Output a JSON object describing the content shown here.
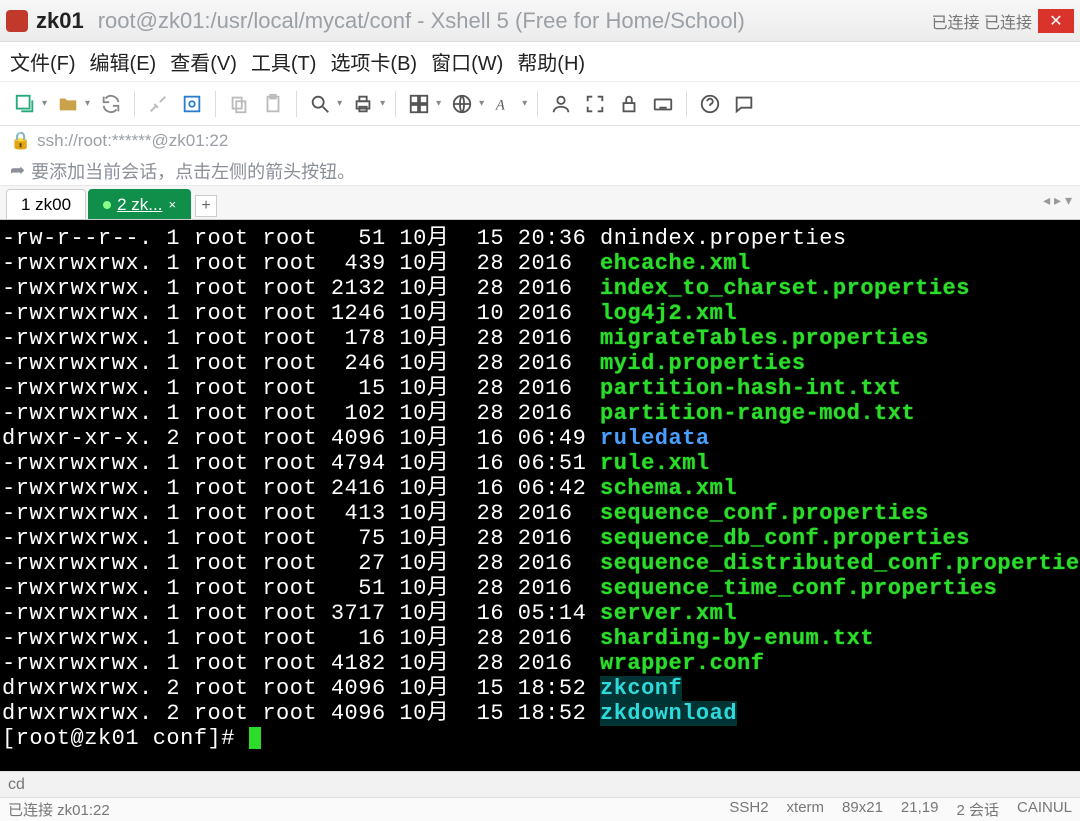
{
  "title": {
    "session_name": "zk01",
    "full": "root@zk01:/usr/local/mycat/conf - Xshell 5 (Free for Home/School)",
    "conn_status": "已连接 已连接"
  },
  "menu": {
    "file": "文件(F)",
    "edit": "编辑(E)",
    "view": "查看(V)",
    "tools": "工具(T)",
    "tab": "选项卡(B)",
    "window": "窗口(W)",
    "help": "帮助(H)"
  },
  "addr": {
    "icon": "🔒",
    "text": "ssh://root:******@zk01:22"
  },
  "hint": {
    "icon": "➦",
    "text": "要添加当前会话，点击左侧的箭头按钮。"
  },
  "tabs": {
    "t1": "1 zk00",
    "t2": "2 zk...",
    "add": "+"
  },
  "files": [
    {
      "perm": "rw-r--r--.",
      "n": "1",
      "u": "root",
      "g": "root",
      "sz": "  51",
      "m": "10月",
      "d": "15",
      "t": "20:36",
      "name": "dnindex.properties",
      "cls": ""
    },
    {
      "perm": "rwxrwxrwx.",
      "n": "1",
      "u": "root",
      "g": "root",
      "sz": " 439",
      "m": "10月",
      "d": "28",
      "t": "2016 ",
      "name": "ehcache.xml",
      "cls": "fg-green"
    },
    {
      "perm": "rwxrwxrwx.",
      "n": "1",
      "u": "root",
      "g": "root",
      "sz": "2132",
      "m": "10月",
      "d": "28",
      "t": "2016 ",
      "name": "index_to_charset.properties",
      "cls": "fg-green"
    },
    {
      "perm": "rwxrwxrwx.",
      "n": "1",
      "u": "root",
      "g": "root",
      "sz": "1246",
      "m": "10月",
      "d": "10",
      "t": "2016 ",
      "name": "log4j2.xml",
      "cls": "fg-green"
    },
    {
      "perm": "rwxrwxrwx.",
      "n": "1",
      "u": "root",
      "g": "root",
      "sz": " 178",
      "m": "10月",
      "d": "28",
      "t": "2016 ",
      "name": "migrateTables.properties",
      "cls": "fg-green"
    },
    {
      "perm": "rwxrwxrwx.",
      "n": "1",
      "u": "root",
      "g": "root",
      "sz": " 246",
      "m": "10月",
      "d": "28",
      "t": "2016 ",
      "name": "myid.properties",
      "cls": "fg-green"
    },
    {
      "perm": "rwxrwxrwx.",
      "n": "1",
      "u": "root",
      "g": "root",
      "sz": "  15",
      "m": "10月",
      "d": "28",
      "t": "2016 ",
      "name": "partition-hash-int.txt",
      "cls": "fg-green"
    },
    {
      "perm": "rwxrwxrwx.",
      "n": "1",
      "u": "root",
      "g": "root",
      "sz": " 102",
      "m": "10月",
      "d": "28",
      "t": "2016 ",
      "name": "partition-range-mod.txt",
      "cls": "fg-green"
    },
    {
      "perm": "drwxr-xr-x.",
      "n": "2",
      "u": "root",
      "g": "root",
      "sz": "4096",
      "m": "10月",
      "d": "16",
      "t": "06:49",
      "name": "ruledata",
      "cls": "fg-blue",
      "pad": ""
    },
    {
      "perm": "rwxrwxrwx.",
      "n": "1",
      "u": "root",
      "g": "root",
      "sz": "4794",
      "m": "10月",
      "d": "16",
      "t": "06:51",
      "name": "rule.xml",
      "cls": "fg-green"
    },
    {
      "perm": "rwxrwxrwx.",
      "n": "1",
      "u": "root",
      "g": "root",
      "sz": "2416",
      "m": "10月",
      "d": "16",
      "t": "06:42",
      "name": "schema.xml",
      "cls": "fg-green"
    },
    {
      "perm": "rwxrwxrwx.",
      "n": "1",
      "u": "root",
      "g": "root",
      "sz": " 413",
      "m": "10月",
      "d": "28",
      "t": "2016 ",
      "name": "sequence_conf.properties",
      "cls": "fg-green"
    },
    {
      "perm": "rwxrwxrwx.",
      "n": "1",
      "u": "root",
      "g": "root",
      "sz": "  75",
      "m": "10月",
      "d": "28",
      "t": "2016 ",
      "name": "sequence_db_conf.properties",
      "cls": "fg-green"
    },
    {
      "perm": "rwxrwxrwx.",
      "n": "1",
      "u": "root",
      "g": "root",
      "sz": "  27",
      "m": "10月",
      "d": "28",
      "t": "2016 ",
      "name": "sequence_distributed_conf.properties",
      "cls": "fg-green"
    },
    {
      "perm": "rwxrwxrwx.",
      "n": "1",
      "u": "root",
      "g": "root",
      "sz": "  51",
      "m": "10月",
      "d": "28",
      "t": "2016 ",
      "name": "sequence_time_conf.properties",
      "cls": "fg-green"
    },
    {
      "perm": "rwxrwxrwx.",
      "n": "1",
      "u": "root",
      "g": "root",
      "sz": "3717",
      "m": "10月",
      "d": "16",
      "t": "05:14",
      "name": "server.xml",
      "cls": "fg-green"
    },
    {
      "perm": "rwxrwxrwx.",
      "n": "1",
      "u": "root",
      "g": "root",
      "sz": "  16",
      "m": "10月",
      "d": "28",
      "t": "2016 ",
      "name": "sharding-by-enum.txt",
      "cls": "fg-green"
    },
    {
      "perm": "rwxrwxrwx.",
      "n": "1",
      "u": "root",
      "g": "root",
      "sz": "4182",
      "m": "10月",
      "d": "28",
      "t": "2016 ",
      "name": "wrapper.conf",
      "cls": "fg-green"
    },
    {
      "perm": "drwxrwxrwx.",
      "n": "2",
      "u": "root",
      "g": "root",
      "sz": "4096",
      "m": "10月",
      "d": "15",
      "t": "18:52",
      "name": "zkconf",
      "cls": "fg-cyan",
      "pad": ""
    },
    {
      "perm": "drwxrwxrwx.",
      "n": "2",
      "u": "root",
      "g": "root",
      "sz": "4096",
      "m": "10月",
      "d": "15",
      "t": "18:52",
      "name": "zkdownload",
      "cls": "fg-cyan",
      "pad": ""
    }
  ],
  "prompt": "[root@zk01 conf]# ",
  "bottom": {
    "cd": "cd"
  },
  "status": {
    "left": "已连接 zk01:22",
    "ssh": "SSH2",
    "term": "xterm",
    "size": "89x21",
    "pos": "21,19",
    "sess": "2 会话",
    "cap": "CAINUL"
  }
}
